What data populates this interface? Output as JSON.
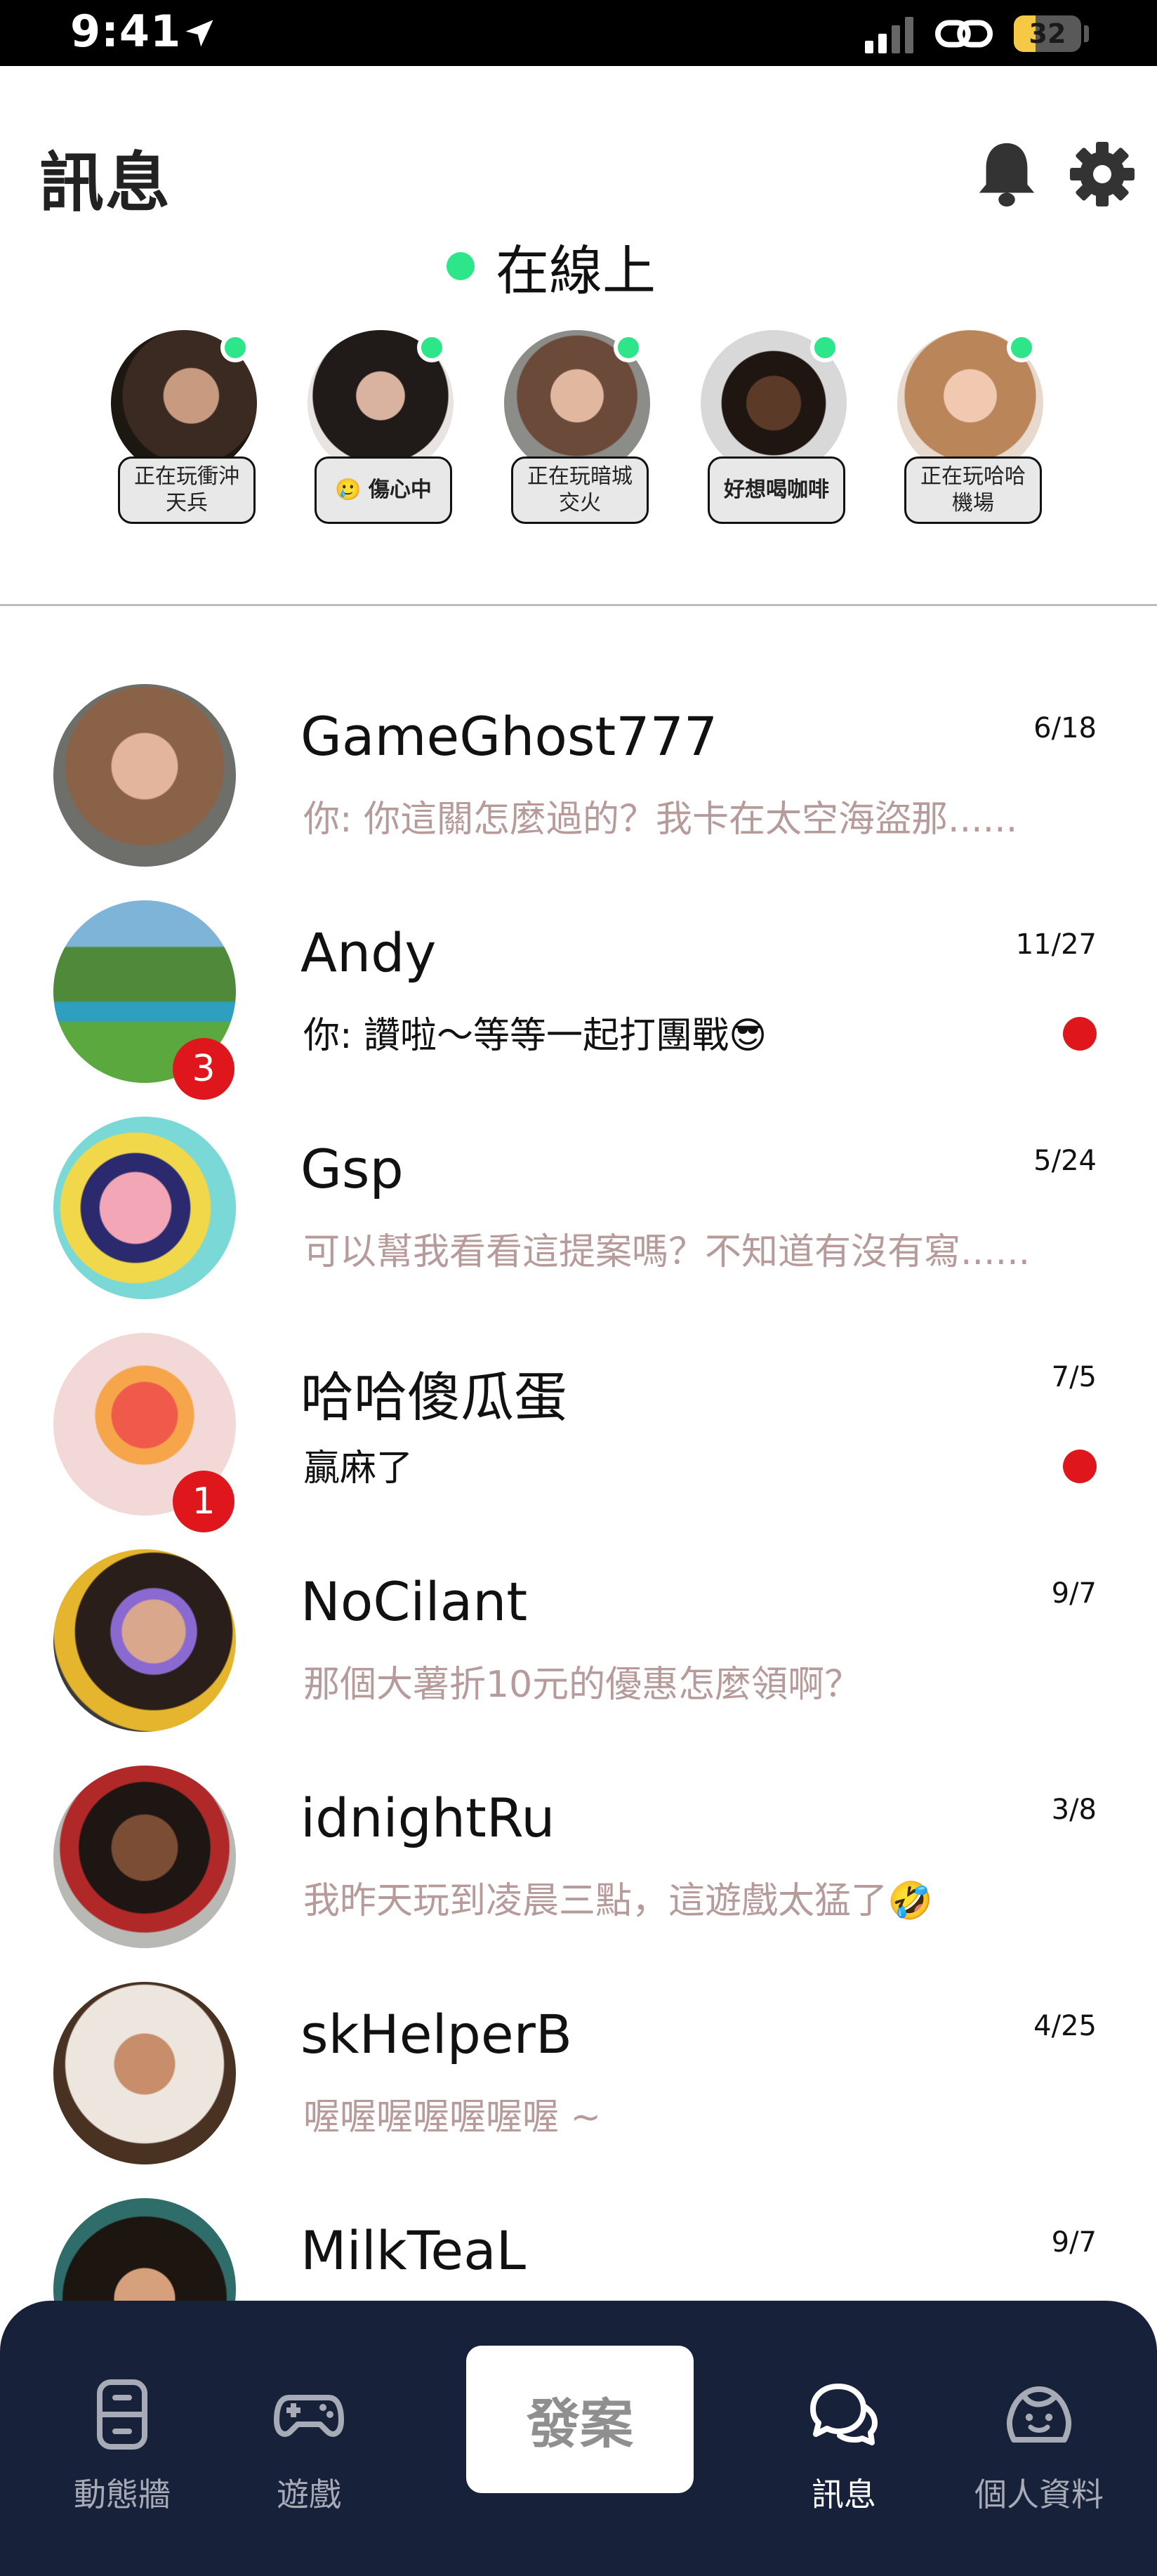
{
  "status_bar": {
    "time": "9:41",
    "battery": "32"
  },
  "header": {
    "title": "訊息"
  },
  "online": {
    "label": "在線上",
    "friends": [
      {
        "status": "正在玩衝沖天兵",
        "bold": false
      },
      {
        "status": "🥲 傷心中",
        "bold": true
      },
      {
        "status": "正在玩暗城交火",
        "bold": false
      },
      {
        "status": "好想喝咖啡",
        "bold": true
      },
      {
        "status": "正在玩哈哈機場",
        "bold": false
      }
    ]
  },
  "conversations": [
    {
      "name": "GameGhost777",
      "date": "6/18",
      "preview": "你: 你這關怎麼過的？我卡在太空海盜那......",
      "unread": false,
      "badge": null
    },
    {
      "name": "Andy",
      "date": "11/27",
      "preview": "你: 讚啦～等等一起打團戰😎",
      "unread": true,
      "badge": "3"
    },
    {
      "name": "Gsp",
      "date": "5/24",
      "preview": "可以幫我看看這提案嗎？不知道有沒有寫......",
      "unread": false,
      "badge": null
    },
    {
      "name": "哈哈傻瓜蛋",
      "date": "7/5",
      "preview": "贏麻了",
      "unread": true,
      "badge": "1"
    },
    {
      "name": "NoCilant",
      "date": "9/7",
      "preview": "那個大薯折10元的優惠怎麼領啊？",
      "unread": false,
      "badge": null
    },
    {
      "name": "idnightRu",
      "date": "3/8",
      "preview": "我昨天玩到凌晨三點，這遊戲太猛了🤣",
      "unread": false,
      "badge": null
    },
    {
      "name": "skHelperB",
      "date": "4/25",
      "preview": "喔喔喔喔喔喔喔 ~",
      "unread": false,
      "badge": null
    },
    {
      "name": "MilkTeaL",
      "date": "9/7",
      "preview": "",
      "unread": false,
      "badge": null
    }
  ],
  "tab_bar": {
    "tabs": [
      {
        "label": "動態牆",
        "icon": "phone-icon"
      },
      {
        "label": "遊戲",
        "icon": "gamepad-icon"
      },
      {
        "label": "訊息",
        "icon": "chat-bubbles-icon",
        "active": true
      },
      {
        "label": "個人資料",
        "icon": "person-face-icon"
      }
    ],
    "post_button": "發案"
  }
}
